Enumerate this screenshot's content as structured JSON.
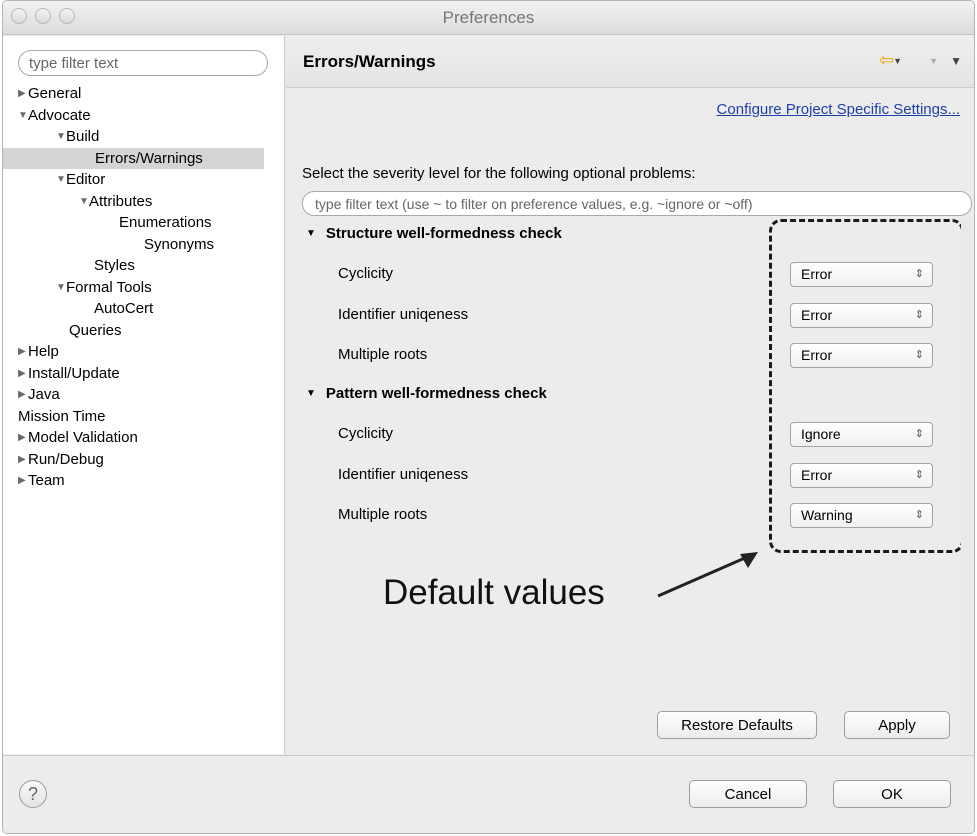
{
  "window": {
    "title": "Preferences"
  },
  "sidebar": {
    "filter_placeholder": "type filter text",
    "items": [
      {
        "label": "General",
        "twisty": "▶"
      },
      {
        "label": "Advocate",
        "twisty": "▼"
      },
      {
        "label": "Build",
        "twisty": "▼"
      },
      {
        "label": "Errors/Warnings"
      },
      {
        "label": "Editor",
        "twisty": "▼"
      },
      {
        "label": "Attributes",
        "twisty": "▼"
      },
      {
        "label": "Enumerations"
      },
      {
        "label": "Synonyms"
      },
      {
        "label": "Styles"
      },
      {
        "label": "Formal Tools",
        "twisty": "▼"
      },
      {
        "label": "AutoCert"
      },
      {
        "label": "Queries"
      },
      {
        "label": "Help",
        "twisty": "▶"
      },
      {
        "label": "Install/Update",
        "twisty": "▶"
      },
      {
        "label": "Java",
        "twisty": "▶"
      },
      {
        "label": "Mission Time"
      },
      {
        "label": "Model Validation",
        "twisty": "▶"
      },
      {
        "label": "Run/Debug",
        "twisty": "▶"
      },
      {
        "label": "Team",
        "twisty": "▶"
      }
    ],
    "selected": "Errors/Warnings"
  },
  "header": {
    "title": "Errors/Warnings",
    "icons": {
      "back": "back-arrow-icon",
      "back_menu": "dropdown-icon",
      "forward": "forward-icon",
      "view_menu": "view-menu-icon"
    }
  },
  "main": {
    "configure_link": "Configure Project Specific Settings...",
    "intro": "Select the severity level for the following optional problems:",
    "filter_placeholder": "type filter text (use ~ to filter on preference values, e.g. ~ignore or ~off)",
    "sections": [
      {
        "title": "Structure well-formedness check",
        "options": [
          {
            "label": "Cyclicity",
            "value": "Error"
          },
          {
            "label": "Identifier uniqeness",
            "value": "Error"
          },
          {
            "label": "Multiple roots",
            "value": "Error"
          }
        ]
      },
      {
        "title": "Pattern well-formedness check",
        "options": [
          {
            "label": "Cyclicity",
            "value": "Ignore"
          },
          {
            "label": "Identifier uniqeness",
            "value": "Error"
          },
          {
            "label": "Multiple roots",
            "value": "Warning"
          }
        ]
      }
    ],
    "annotation": "Default values",
    "restore_defaults": "Restore Defaults",
    "apply": "Apply"
  },
  "footer": {
    "help": "?",
    "cancel": "Cancel",
    "ok": "OK"
  },
  "colors": {
    "link": "#1f3fa8",
    "selection": "#d4d4d4",
    "back_icon": "#e6a800"
  }
}
